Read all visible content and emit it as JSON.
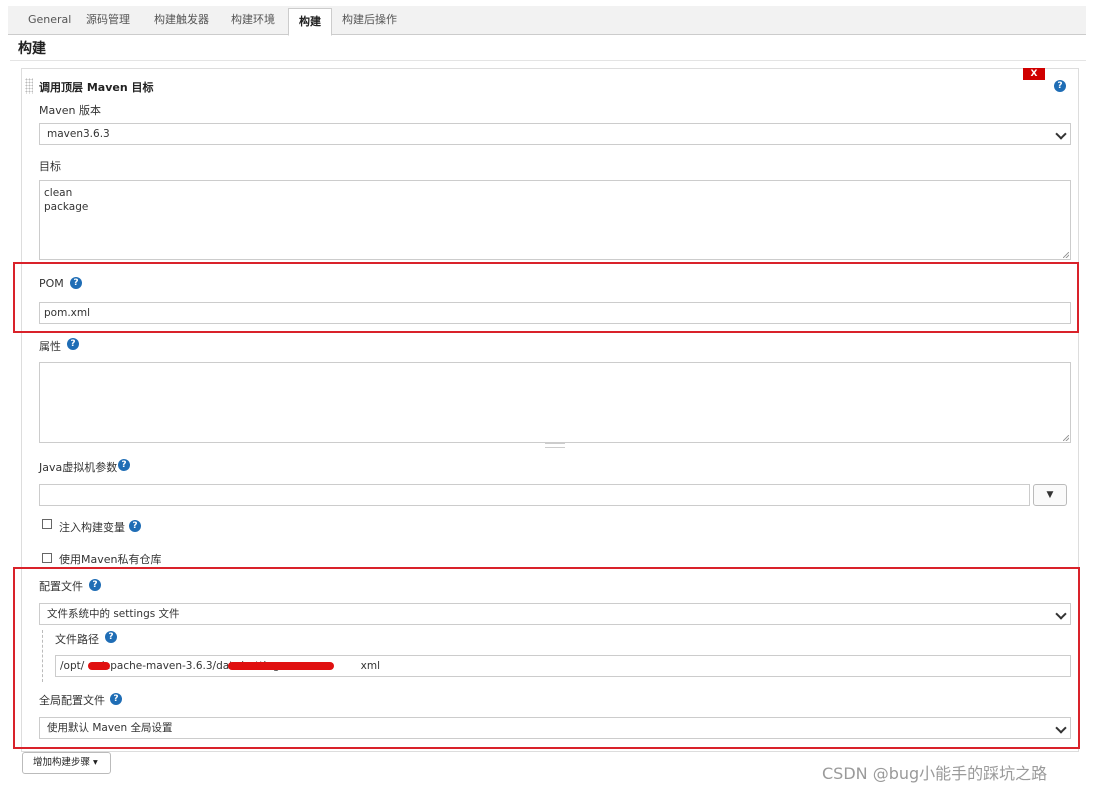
{
  "tabs": [
    {
      "label": "General",
      "active": false
    },
    {
      "label": "源码管理",
      "active": false
    },
    {
      "label": "构建触发器",
      "active": false
    },
    {
      "label": "构建环境",
      "active": false
    },
    {
      "label": "构建",
      "active": true
    },
    {
      "label": "构建后操作",
      "active": false
    }
  ],
  "section": {
    "title": "构建"
  },
  "step": {
    "title": "调用顶层 Maven 目标",
    "delete_label": "X",
    "help": "?"
  },
  "maven_version": {
    "label": "Maven 版本",
    "value": "maven3.6.3"
  },
  "goals": {
    "label": "目标",
    "lines": [
      "clean",
      "package"
    ]
  },
  "pom": {
    "label": "POM",
    "value": "pom.xml"
  },
  "properties": {
    "label": "属性",
    "value": ""
  },
  "jvm": {
    "label": "Java虚拟机参数",
    "value": "",
    "dropdown_glyph": "▼"
  },
  "inject_vars": {
    "label": "注入构建变量",
    "checked": false
  },
  "private_repo": {
    "label": "使用Maven私有仓库",
    "checked": false
  },
  "settings": {
    "label": "配置文件",
    "value": "文件系统中的 settings 文件",
    "path_label": "文件路径",
    "path_prefix": "/opt/",
    "path_mid": "/apache-maven-3.6.3/data/setting",
    "path_suffix": "xml"
  },
  "global_settings": {
    "label": "全局配置文件",
    "value": "使用默认 Maven 全局设置"
  },
  "add_step": {
    "label": "增加构建步骤",
    "caret": "▾"
  },
  "watermark": "CSDN @bug小能手的踩坑之路",
  "colors": {
    "highlight": "#d9222a",
    "help_icon": "#1f6db5",
    "delete": "#d00000"
  }
}
